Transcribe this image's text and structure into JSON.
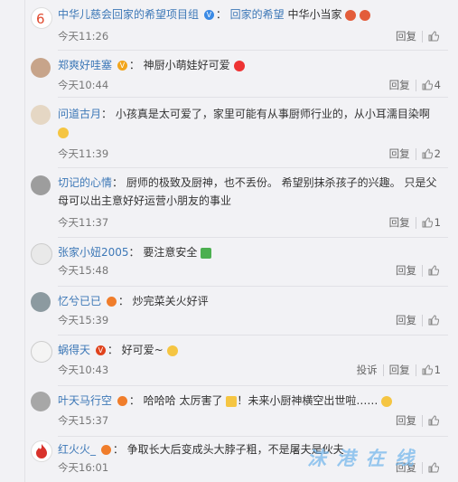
{
  "comments": [
    {
      "name": "中华儿慈会回家的希望项目组",
      "text": "回家的希望 中华小当家",
      "time": "今天11:26",
      "reply": "回复",
      "likes": ""
    },
    {
      "name": "郑爽好哇塞",
      "text": "神厨小萌娃好可爱",
      "time": "今天10:44",
      "reply": "回复",
      "likes": "4"
    },
    {
      "name": "问道古月",
      "text_line1": "小孩真是太可爱了，家里可能有从事厨师行业的，从小耳濡目染啊",
      "time": "今天11:39",
      "reply": "回复",
      "likes": "2"
    },
    {
      "name": "切记的心情",
      "text_line1": "厨师的极致及厨神，也不丢份。 希望别抹杀孩子的兴趣。 只是父",
      "text_line2": "母可以出主意好好运营小朋友的事业",
      "time": "今天11:37",
      "reply": "回复",
      "likes": "1"
    },
    {
      "name": "张家小妞2005",
      "text": "要注意安全",
      "time": "今天15:48",
      "reply": "回复",
      "likes": ""
    },
    {
      "name": "忆兮已已",
      "text": "炒完菜关火好评",
      "time": "今天15:39",
      "reply": "回复",
      "likes": ""
    },
    {
      "name": "蜗得天",
      "text": "好可爱~",
      "time": "今天10:43",
      "report": "投诉",
      "reply": "回复",
      "likes": "1"
    },
    {
      "name": "叶天马行空",
      "text": "哈哈哈 太厉害了",
      "text2": "！未来小厨神横空出世啦……",
      "time": "今天15:37",
      "reply": "回复",
      "likes": ""
    },
    {
      "name": "红火火_",
      "text": "争取长大后变成头大脖子粗，不是屠夫是伙夫",
      "time": "今天16:01",
      "reply": "回复",
      "likes": ""
    }
  ],
  "watermark": "沫 港 在 线"
}
